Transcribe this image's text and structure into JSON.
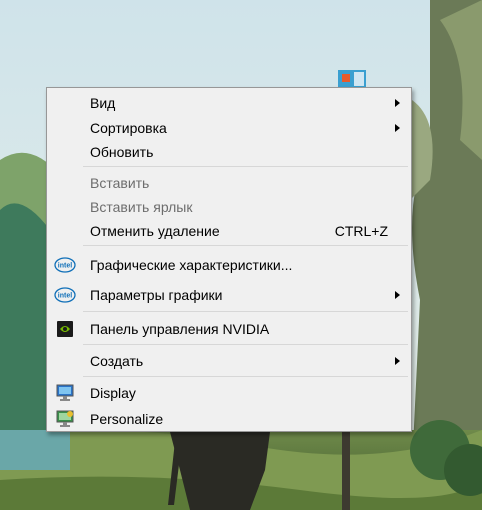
{
  "context_menu": {
    "items": [
      {
        "label": "Вид",
        "submenu": true,
        "enabled": true
      },
      {
        "label": "Сортировка",
        "submenu": true,
        "enabled": true
      },
      {
        "label": "Обновить",
        "submenu": false,
        "enabled": true
      },
      {
        "label": "Вставить",
        "submenu": false,
        "enabled": false
      },
      {
        "label": "Вставить ярлык",
        "submenu": false,
        "enabled": false
      },
      {
        "label": "Отменить удаление",
        "shortcut": "CTRL+Z",
        "submenu": false,
        "enabled": true
      },
      {
        "label": "Графические характеристики...",
        "icon": "intel-icon",
        "submenu": false,
        "enabled": true
      },
      {
        "label": "Параметры графики",
        "icon": "intel-icon",
        "submenu": true,
        "enabled": true
      },
      {
        "label": "Панель управления NVIDIA",
        "icon": "nvidia-icon",
        "submenu": false,
        "enabled": true
      },
      {
        "label": "Создать",
        "submenu": true,
        "enabled": true
      },
      {
        "label": "Display",
        "icon": "display-icon",
        "submenu": false,
        "enabled": true
      },
      {
        "label": "Personalize",
        "icon": "personalize-icon",
        "submenu": false,
        "enabled": true
      }
    ],
    "intel_logo_text": "intel"
  },
  "colors": {
    "menu_bg": "#f0f0f0",
    "menu_border": "#979797",
    "disabled_text": "#6d6d6d",
    "separator": "#d7d7d7"
  }
}
